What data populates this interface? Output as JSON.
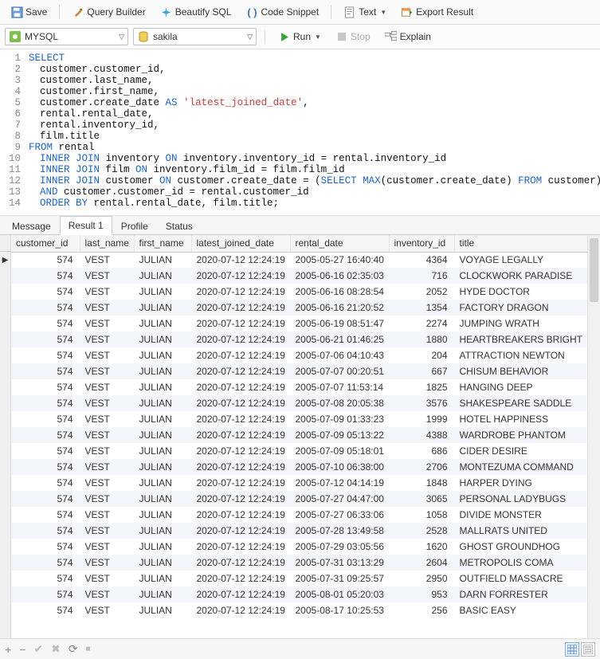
{
  "toolbar1": {
    "save": "Save",
    "query_builder": "Query Builder",
    "beautify": "Beautify SQL",
    "code_snippet": "Code Snippet",
    "text": "Text",
    "export": "Export Result"
  },
  "toolbar2": {
    "db_engine": "MYSQL",
    "schema": "sakila",
    "run": "Run",
    "stop": "Stop",
    "explain": "Explain"
  },
  "sql": {
    "lines": [
      {
        "n": "1",
        "indent": 0,
        "tokens": [
          {
            "t": "SELECT",
            "c": "kw"
          }
        ]
      },
      {
        "n": "2",
        "indent": 1,
        "tokens": [
          {
            "t": "customer.customer_id,"
          }
        ]
      },
      {
        "n": "3",
        "indent": 1,
        "tokens": [
          {
            "t": "customer.last_name,"
          }
        ]
      },
      {
        "n": "4",
        "indent": 1,
        "tokens": [
          {
            "t": "customer.first_name,"
          }
        ]
      },
      {
        "n": "5",
        "indent": 1,
        "tokens": [
          {
            "t": "customer.create_date "
          },
          {
            "t": "AS",
            "c": "kw"
          },
          {
            "t": " "
          },
          {
            "t": "'latest_joined_date'",
            "c": "str"
          },
          {
            "t": ","
          }
        ]
      },
      {
        "n": "6",
        "indent": 1,
        "tokens": [
          {
            "t": "rental.rental_date,"
          }
        ]
      },
      {
        "n": "7",
        "indent": 1,
        "tokens": [
          {
            "t": "rental.inventory_id,"
          }
        ]
      },
      {
        "n": "8",
        "indent": 1,
        "tokens": [
          {
            "t": "film.title"
          }
        ]
      },
      {
        "n": "9",
        "indent": 0,
        "tokens": [
          {
            "t": "FROM",
            "c": "kw"
          },
          {
            "t": " rental"
          }
        ]
      },
      {
        "n": "10",
        "indent": 1,
        "tokens": [
          {
            "t": "INNER JOIN",
            "c": "kw"
          },
          {
            "t": " inventory "
          },
          {
            "t": "ON",
            "c": "kw"
          },
          {
            "t": " inventory.inventory_id = rental.inventory_id"
          }
        ]
      },
      {
        "n": "11",
        "indent": 1,
        "tokens": [
          {
            "t": "INNER JOIN",
            "c": "kw"
          },
          {
            "t": " film "
          },
          {
            "t": "ON",
            "c": "kw"
          },
          {
            "t": " inventory.film_id = film.film_id"
          }
        ]
      },
      {
        "n": "12",
        "indent": 1,
        "tokens": [
          {
            "t": "INNER JOIN",
            "c": "kw"
          },
          {
            "t": " customer "
          },
          {
            "t": "ON",
            "c": "kw"
          },
          {
            "t": " customer.create_date = ("
          },
          {
            "t": "SELECT",
            "c": "kw"
          },
          {
            "t": " "
          },
          {
            "t": "MAX",
            "c": "kw"
          },
          {
            "t": "(customer.create_date) "
          },
          {
            "t": "FROM",
            "c": "kw"
          },
          {
            "t": " customer)"
          }
        ]
      },
      {
        "n": "13",
        "indent": 1,
        "tokens": [
          {
            "t": "AND",
            "c": "kw"
          },
          {
            "t": " customer.customer_id = rental.customer_id"
          }
        ]
      },
      {
        "n": "14",
        "indent": 1,
        "tokens": [
          {
            "t": "ORDER BY",
            "c": "kw"
          },
          {
            "t": " rental.rental_date, film.title;"
          }
        ]
      }
    ]
  },
  "tabs": {
    "items": [
      "Message",
      "Result 1",
      "Profile",
      "Status"
    ],
    "active": 1
  },
  "grid": {
    "columns": [
      "customer_id",
      "last_name",
      "first_name",
      "latest_joined_date",
      "rental_date",
      "inventory_id",
      "title"
    ],
    "rows": [
      {
        "customer_id": 574,
        "last_name": "VEST",
        "first_name": "JULIAN",
        "latest_joined_date": "2020-07-12 12:24:19",
        "rental_date": "2005-05-27 16:40:40",
        "inventory_id": 4364,
        "title": "VOYAGE LEGALLY"
      },
      {
        "customer_id": 574,
        "last_name": "VEST",
        "first_name": "JULIAN",
        "latest_joined_date": "2020-07-12 12:24:19",
        "rental_date": "2005-06-16 02:35:03",
        "inventory_id": 716,
        "title": "CLOCKWORK PARADISE"
      },
      {
        "customer_id": 574,
        "last_name": "VEST",
        "first_name": "JULIAN",
        "latest_joined_date": "2020-07-12 12:24:19",
        "rental_date": "2005-06-16 08:28:54",
        "inventory_id": 2052,
        "title": "HYDE DOCTOR"
      },
      {
        "customer_id": 574,
        "last_name": "VEST",
        "first_name": "JULIAN",
        "latest_joined_date": "2020-07-12 12:24:19",
        "rental_date": "2005-06-16 21:20:52",
        "inventory_id": 1354,
        "title": "FACTORY DRAGON"
      },
      {
        "customer_id": 574,
        "last_name": "VEST",
        "first_name": "JULIAN",
        "latest_joined_date": "2020-07-12 12:24:19",
        "rental_date": "2005-06-19 08:51:47",
        "inventory_id": 2274,
        "title": "JUMPING WRATH"
      },
      {
        "customer_id": 574,
        "last_name": "VEST",
        "first_name": "JULIAN",
        "latest_joined_date": "2020-07-12 12:24:19",
        "rental_date": "2005-06-21 01:46:25",
        "inventory_id": 1880,
        "title": "HEARTBREAKERS BRIGHT"
      },
      {
        "customer_id": 574,
        "last_name": "VEST",
        "first_name": "JULIAN",
        "latest_joined_date": "2020-07-12 12:24:19",
        "rental_date": "2005-07-06 04:10:43",
        "inventory_id": 204,
        "title": "ATTRACTION NEWTON"
      },
      {
        "customer_id": 574,
        "last_name": "VEST",
        "first_name": "JULIAN",
        "latest_joined_date": "2020-07-12 12:24:19",
        "rental_date": "2005-07-07 00:20:51",
        "inventory_id": 667,
        "title": "CHISUM BEHAVIOR"
      },
      {
        "customer_id": 574,
        "last_name": "VEST",
        "first_name": "JULIAN",
        "latest_joined_date": "2020-07-12 12:24:19",
        "rental_date": "2005-07-07 11:53:14",
        "inventory_id": 1825,
        "title": "HANGING DEEP"
      },
      {
        "customer_id": 574,
        "last_name": "VEST",
        "first_name": "JULIAN",
        "latest_joined_date": "2020-07-12 12:24:19",
        "rental_date": "2005-07-08 20:05:38",
        "inventory_id": 3576,
        "title": "SHAKESPEARE SADDLE"
      },
      {
        "customer_id": 574,
        "last_name": "VEST",
        "first_name": "JULIAN",
        "latest_joined_date": "2020-07-12 12:24:19",
        "rental_date": "2005-07-09 01:33:23",
        "inventory_id": 1999,
        "title": "HOTEL HAPPINESS"
      },
      {
        "customer_id": 574,
        "last_name": "VEST",
        "first_name": "JULIAN",
        "latest_joined_date": "2020-07-12 12:24:19",
        "rental_date": "2005-07-09 05:13:22",
        "inventory_id": 4388,
        "title": "WARDROBE PHANTOM"
      },
      {
        "customer_id": 574,
        "last_name": "VEST",
        "first_name": "JULIAN",
        "latest_joined_date": "2020-07-12 12:24:19",
        "rental_date": "2005-07-09 05:18:01",
        "inventory_id": 686,
        "title": "CIDER DESIRE"
      },
      {
        "customer_id": 574,
        "last_name": "VEST",
        "first_name": "JULIAN",
        "latest_joined_date": "2020-07-12 12:24:19",
        "rental_date": "2005-07-10 06:38:00",
        "inventory_id": 2706,
        "title": "MONTEZUMA COMMAND"
      },
      {
        "customer_id": 574,
        "last_name": "VEST",
        "first_name": "JULIAN",
        "latest_joined_date": "2020-07-12 12:24:19",
        "rental_date": "2005-07-12 04:14:19",
        "inventory_id": 1848,
        "title": "HARPER DYING"
      },
      {
        "customer_id": 574,
        "last_name": "VEST",
        "first_name": "JULIAN",
        "latest_joined_date": "2020-07-12 12:24:19",
        "rental_date": "2005-07-27 04:47:00",
        "inventory_id": 3065,
        "title": "PERSONAL LADYBUGS"
      },
      {
        "customer_id": 574,
        "last_name": "VEST",
        "first_name": "JULIAN",
        "latest_joined_date": "2020-07-12 12:24:19",
        "rental_date": "2005-07-27 06:33:06",
        "inventory_id": 1058,
        "title": "DIVIDE MONSTER"
      },
      {
        "customer_id": 574,
        "last_name": "VEST",
        "first_name": "JULIAN",
        "latest_joined_date": "2020-07-12 12:24:19",
        "rental_date": "2005-07-28 13:49:58",
        "inventory_id": 2528,
        "title": "MALLRATS UNITED"
      },
      {
        "customer_id": 574,
        "last_name": "VEST",
        "first_name": "JULIAN",
        "latest_joined_date": "2020-07-12 12:24:19",
        "rental_date": "2005-07-29 03:05:56",
        "inventory_id": 1620,
        "title": "GHOST GROUNDHOG"
      },
      {
        "customer_id": 574,
        "last_name": "VEST",
        "first_name": "JULIAN",
        "latest_joined_date": "2020-07-12 12:24:19",
        "rental_date": "2005-07-31 03:13:29",
        "inventory_id": 2604,
        "title": "METROPOLIS COMA"
      },
      {
        "customer_id": 574,
        "last_name": "VEST",
        "first_name": "JULIAN",
        "latest_joined_date": "2020-07-12 12:24:19",
        "rental_date": "2005-07-31 09:25:57",
        "inventory_id": 2950,
        "title": "OUTFIELD MASSACRE"
      },
      {
        "customer_id": 574,
        "last_name": "VEST",
        "first_name": "JULIAN",
        "latest_joined_date": "2020-07-12 12:24:19",
        "rental_date": "2005-08-01 05:20:03",
        "inventory_id": 953,
        "title": "DARN FORRESTER"
      },
      {
        "customer_id": 574,
        "last_name": "VEST",
        "first_name": "JULIAN",
        "latest_joined_date": "2020-07-12 12:24:19",
        "rental_date": "2005-08-17 10:25:53",
        "inventory_id": 256,
        "title": "BASIC EASY"
      }
    ],
    "selected_row": 0
  },
  "footer": {
    "glyphs": {
      "add": "+",
      "remove": "−",
      "apply": "✔",
      "cancel": "✖",
      "refresh": "⟳",
      "stop_edit": "■"
    }
  }
}
